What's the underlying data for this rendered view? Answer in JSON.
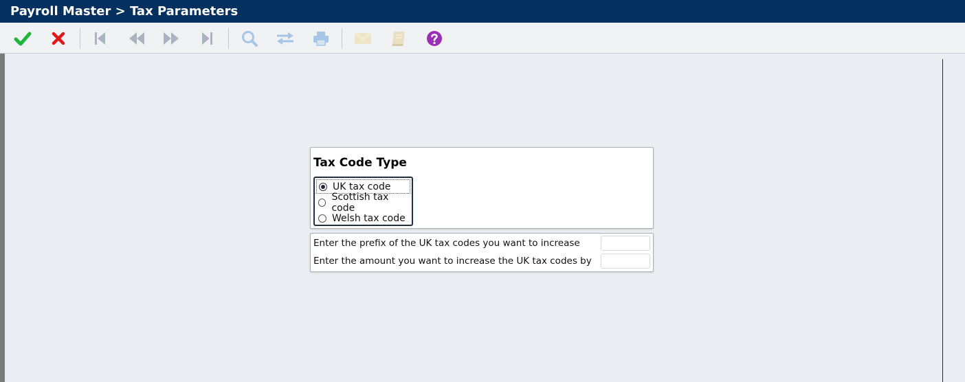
{
  "window": {
    "title": "Payroll Master > Tax Parameters"
  },
  "toolbar": {
    "buttons": [
      {
        "name": "ok",
        "icon": "checkmark-icon",
        "color": "#1db53b",
        "enabled": true
      },
      {
        "name": "cancel",
        "icon": "x-icon",
        "color": "#e01818",
        "enabled": true
      },
      {
        "name": "first",
        "icon": "first-record-icon",
        "enabled": false
      },
      {
        "name": "previous",
        "icon": "previous-record-icon",
        "enabled": false
      },
      {
        "name": "next",
        "icon": "next-record-icon",
        "enabled": false
      },
      {
        "name": "last",
        "icon": "last-record-icon",
        "enabled": false
      },
      {
        "name": "search",
        "icon": "magnifier-icon",
        "enabled": false
      },
      {
        "name": "swap",
        "icon": "swap-arrows-icon",
        "enabled": false
      },
      {
        "name": "print",
        "icon": "printer-icon",
        "enabled": false
      },
      {
        "name": "email",
        "icon": "envelope-icon",
        "enabled": false
      },
      {
        "name": "notes",
        "icon": "book-icon",
        "enabled": false
      },
      {
        "name": "help",
        "icon": "help-circle-icon",
        "color": "#9b2fb5",
        "enabled": true
      }
    ]
  },
  "tax_code_type": {
    "title": "Tax Code Type",
    "options": [
      {
        "label": "UK tax code",
        "selected": true
      },
      {
        "label": "Scottish tax code",
        "selected": false
      },
      {
        "label": "Welsh tax code",
        "selected": false
      }
    ]
  },
  "increase": {
    "prefix_label": "Enter the prefix of the UK tax codes you want to increase",
    "prefix_value": "",
    "amount_label": "Enter the amount you want to increase the UK tax codes by",
    "amount_value": ""
  },
  "colors": {
    "titlebar": "#03305f",
    "background": "#eaedf1",
    "disabled_icon": "#a9b4c0"
  }
}
